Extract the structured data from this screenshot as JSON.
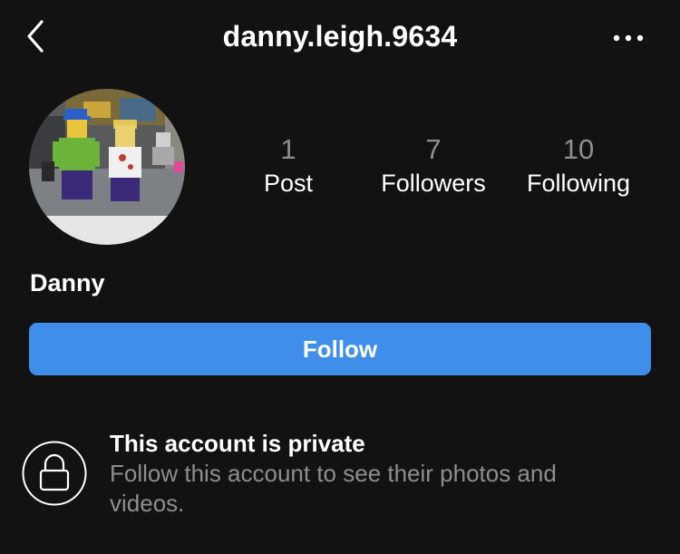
{
  "header": {
    "back_icon": "chevron-left-icon",
    "username": "danny.leigh.9634",
    "more_icon": "more-horizontal-icon"
  },
  "profile": {
    "avatar_icon": "profile-photo",
    "display_name": "Danny"
  },
  "stats": {
    "posts": {
      "count": "1",
      "label": "Post"
    },
    "followers": {
      "count": "7",
      "label": "Followers"
    },
    "following": {
      "count": "10",
      "label": "Following"
    }
  },
  "actions": {
    "follow_label": "Follow"
  },
  "private_notice": {
    "icon": "lock-icon",
    "title": "This account is private",
    "description": "Follow this account to see their photos and videos."
  },
  "colors": {
    "background": "#121212",
    "primary_button": "#3f8fea",
    "muted_text": "#8e8e8e"
  }
}
